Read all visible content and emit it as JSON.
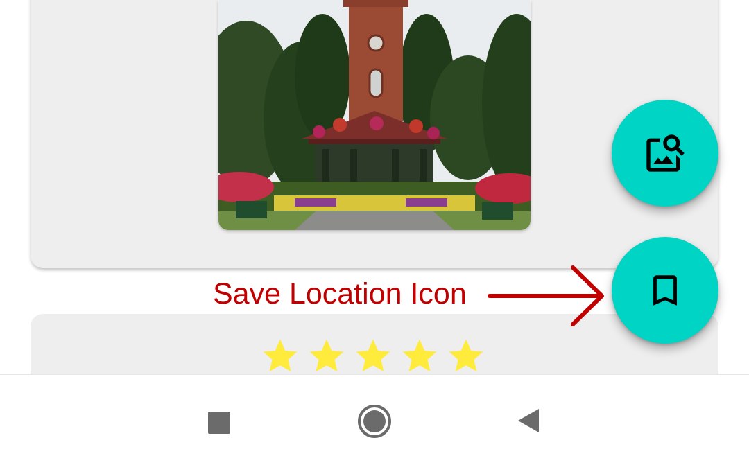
{
  "annotation": {
    "text": "Save Location Icon",
    "color": "#c20000"
  },
  "fabs": {
    "image_search": {
      "icon": "image-search-icon",
      "color": "#00d4c4"
    },
    "save_location": {
      "icon": "bookmark-icon",
      "color": "#00d4c4"
    }
  },
  "rating": {
    "value": 5,
    "max": 5,
    "star_color": "#ffeb3b"
  },
  "photo": {
    "subject": "park-clock-tower-bandstand"
  },
  "navbar": {
    "recents_icon": "square-icon",
    "home_icon": "circle-icon",
    "back_icon": "triangle-icon"
  }
}
